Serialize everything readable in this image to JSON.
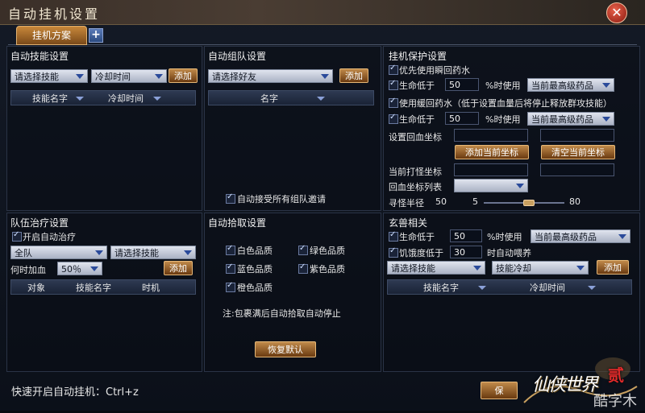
{
  "window": {
    "title": "自动挂机设置",
    "close_label": "✕"
  },
  "tabs": {
    "active": "挂机方案",
    "add": "+"
  },
  "skills": {
    "title": "自动技能设置",
    "skill_select": "请选择技能",
    "cooldown_select": "冷却时间",
    "add": "添加",
    "col_name": "技能名字",
    "col_cd": "冷却时间"
  },
  "team": {
    "title": "自动组队设置",
    "friend_select": "请选择好友",
    "add": "添加",
    "col_name": "名字",
    "accept_all": "自动接受所有组队邀请"
  },
  "protect": {
    "title": "挂机保护设置",
    "prefer_instant": "优先使用瞬回药水",
    "hp_low1": "生命低于",
    "hp_val1": "50",
    "pct_use1": "%时使用",
    "drug_select1": "当前最高级药品",
    "slow_drug": "使用缓回药水",
    "slow_note": "（低于设置血量后将停止释放群攻技能）",
    "hp_low2": "生命低于",
    "hp_val2": "50",
    "pct_use2": "%时使用",
    "drug_select2": "当前最高级药品",
    "set_return": "设置回血坐标",
    "add_coord": "添加当前坐标",
    "clear_coord": "清空当前坐标",
    "current_coord": "当前打怪坐标",
    "return_list": "回血坐标列表",
    "radius_label": "寻怪半径",
    "radius_val": "50",
    "radius_min": "5",
    "radius_max": "80",
    "radius_fraction": 0.55
  },
  "heal": {
    "title": "队伍治疗设置",
    "enable": "开启自动治疗",
    "target_select": "全队",
    "skill_select": "请选择技能",
    "when_label": "何时加血",
    "pct_select": "50％",
    "add": "添加",
    "col_target": "对象",
    "col_skill": "技能名字",
    "col_timing": "时机"
  },
  "pickup": {
    "title": "自动拾取设置",
    "white": "白色品质",
    "green": "绿色品质",
    "blue": "蓝色品质",
    "purple": "紫色品质",
    "orange": "橙色品质",
    "note": "注:包裹满后自动拾取自动停止",
    "restore": "恢复默认"
  },
  "pet": {
    "title": "玄兽相关",
    "hp_low": "生命低于",
    "hp_val": "50",
    "pct_use": "%时使用",
    "drug_select": "当前最高级药品",
    "hunger_low": "饥饿度低于",
    "hunger_val": "30",
    "auto_feed": "时自动喂养",
    "skill_select": "请选择技能",
    "cd_select": "技能冷却",
    "add": "添加",
    "col_name": "技能名字",
    "col_cd": "冷却时间"
  },
  "footer": {
    "hotkey": "快速开启自动挂机：Ctrl+z",
    "bottom_btn": "保"
  },
  "logo": {
    "text": "仙侠世界",
    "badge": "贰",
    "watermark": "酷字木"
  }
}
